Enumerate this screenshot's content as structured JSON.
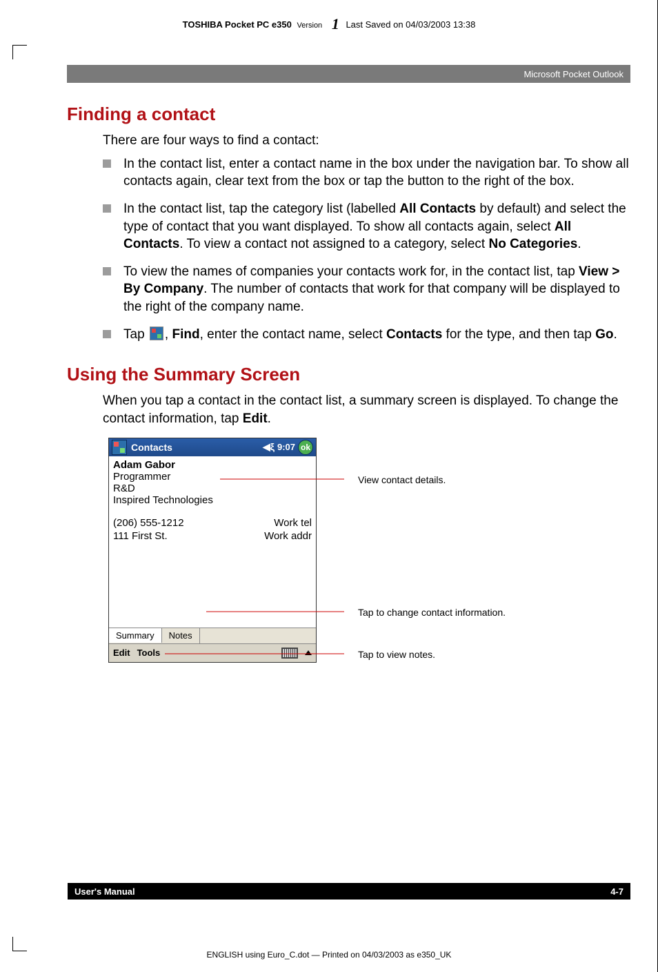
{
  "header": {
    "product_bold": "TOSHIBA Pocket PC e350",
    "version_label": "Version",
    "version_number": "1",
    "saved": "Last Saved on 04/03/2003 13:38"
  },
  "chapter_title": "Microsoft Pocket Outlook",
  "sections": {
    "finding": {
      "heading": "Finding a contact",
      "intro": "There are four ways to find a contact:",
      "items": {
        "b1": "In the contact list, enter a contact name in the box under the navigation bar. To show all contacts again, clear text from the box or tap the button to the right of the box.",
        "b2_pre": "In the contact list, tap the category list (labelled ",
        "b2_bold1": "All Contacts",
        "b2_mid1": " by default) and select the type of contact that you want displayed. To show all contacts again, select ",
        "b2_bold2": "All Contacts",
        "b2_mid2": ". To view a contact not assigned to a category, select ",
        "b2_bold3": "No Categories",
        "b2_end": ".",
        "b3_pre": "To view the names of companies your contacts work for, in the contact list, tap ",
        "b3_bold1": "View > By Company",
        "b3_end": ". The number of contacts that work for that company will be displayed to the right of the company name.",
        "b4_pre": "Tap ",
        "b4_after_icon": ", ",
        "b4_bold1": "Find",
        "b4_mid1": ", enter the contact name, select ",
        "b4_bold2": "Contacts",
        "b4_mid2": " for the type, and then tap ",
        "b4_bold3": "Go",
        "b4_end": "."
      }
    },
    "summary": {
      "heading": "Using the Summary Screen",
      "body_pre": "When you tap a contact in the contact list, a summary screen is displayed. To change the contact information, tap ",
      "body_bold": "Edit",
      "body_end": "."
    }
  },
  "ppc": {
    "title": "Contacts",
    "time": "9:07",
    "ok": "ok",
    "name": "Adam Gabor",
    "role": "Programmer",
    "dept": "R&D",
    "company": "Inspired Technologies",
    "phone": "(206) 555-1212",
    "phone_label": "Work tel",
    "addr": "111 First St.",
    "addr_label": "Work addr",
    "tab_summary": "Summary",
    "tab_notes": "Notes",
    "menu_edit": "Edit",
    "menu_tools": "Tools"
  },
  "callouts": {
    "details": "View contact details.",
    "change": "Tap to change contact information.",
    "notes": "Tap to view notes."
  },
  "footer": {
    "left": "User's Manual",
    "right": "4-7"
  },
  "printline": "ENGLISH using  Euro_C.dot — Printed on 04/03/2003 as e350_UK"
}
